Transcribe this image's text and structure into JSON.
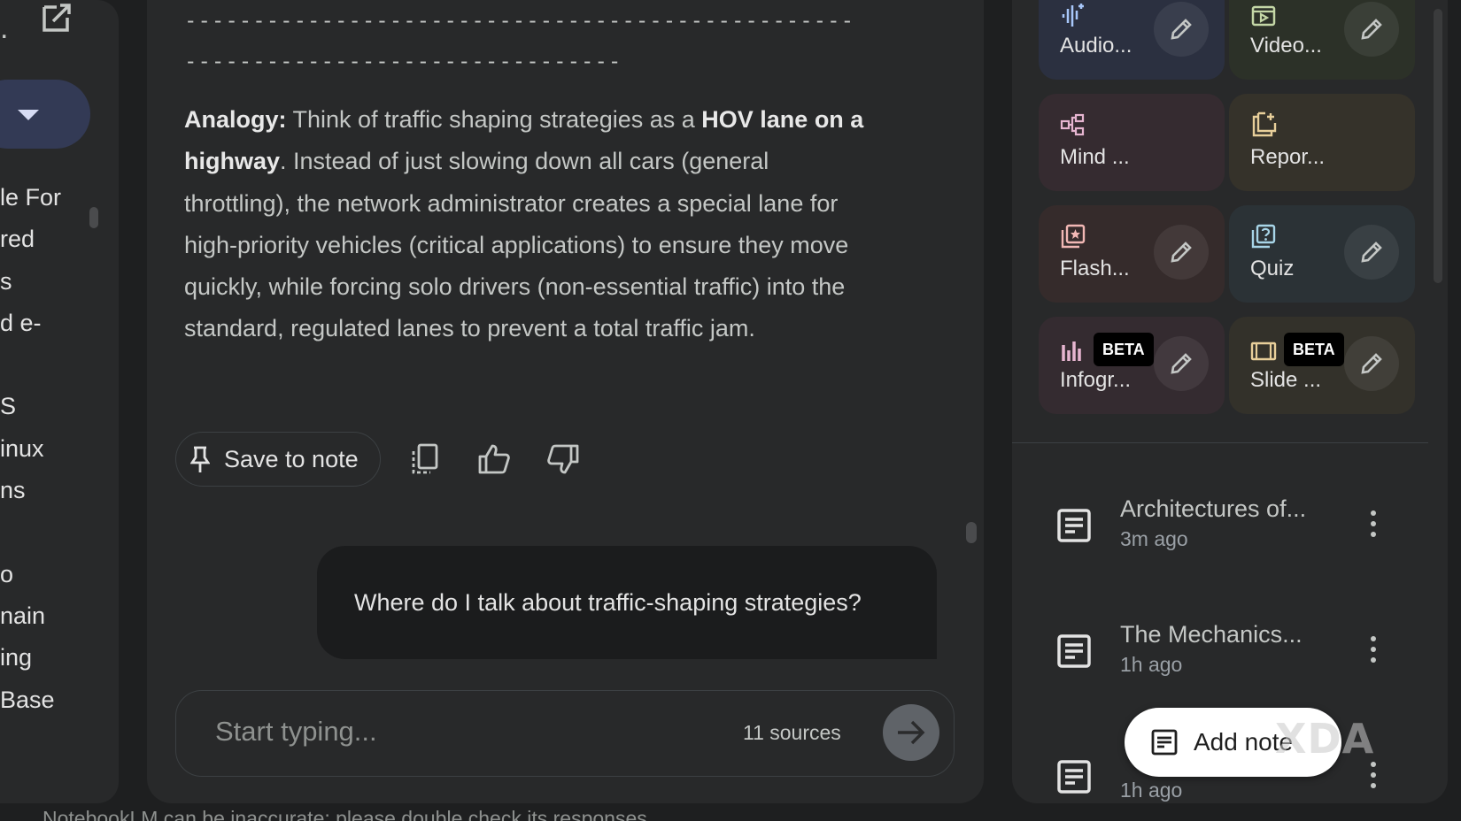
{
  "left_panel": {
    "items": [
      "le For",
      "red",
      "s",
      "d e-",
      "",
      "S",
      "inux",
      "ns",
      "",
      "o",
      "nain",
      "ing",
      " Base"
    ]
  },
  "chat": {
    "dashes": "---------------------------------------------------------------------------------",
    "answer": {
      "analogy_label": "Analogy:",
      "text_1": " Think of traffic shaping strategies as a ",
      "bold_1": "HOV lane on a highway",
      "text_2": ". Instead of just slowing down all cars (general throttling), the network administrator creates a special lane for high-priority vehicles (critical applications) to ensure they move quickly, while forcing solo drivers (non-essential traffic) into the standard, regulated lanes to prevent a total traffic jam."
    },
    "save_to_note": "Save to note",
    "user_message": "Where do I talk about traffic-shaping strategies?",
    "composer": {
      "placeholder": "Start typing...",
      "sources": "11 sources"
    },
    "footer": "NotebookLM can be inaccurate; please double check its responses."
  },
  "studio": {
    "tiles": [
      {
        "label": "Audio...",
        "icon": "audio-icon",
        "color": "#2b3040",
        "edit": true
      },
      {
        "label": "Video...",
        "icon": "video-icon",
        "color": "#2c3128",
        "edit": true
      },
      {
        "label": "Mind ...",
        "icon": "mind-map-icon",
        "color": "#352b30",
        "edit": false
      },
      {
        "label": "Repor...",
        "icon": "report-icon",
        "color": "#35322a",
        "edit": false
      },
      {
        "label": "Flash...",
        "icon": "flashcards-icon",
        "color": "#352b2b",
        "edit": true
      },
      {
        "label": "Quiz",
        "icon": "quiz-icon",
        "color": "#2b3236",
        "edit": true
      },
      {
        "label": "Infogr...",
        "icon": "infographic-icon",
        "color": "#342b30",
        "edit": true,
        "badge": "BETA"
      },
      {
        "label": "Slide ...",
        "icon": "slides-icon",
        "color": "#33312a",
        "edit": true,
        "badge": "BETA"
      }
    ],
    "notes": [
      {
        "title": "Architectures of...",
        "time": "3m ago"
      },
      {
        "title": "The Mechanics...",
        "time": "1h ago"
      },
      {
        "title": "",
        "time": "1h ago"
      }
    ],
    "add_note": "Add note"
  },
  "watermark": "XDA"
}
